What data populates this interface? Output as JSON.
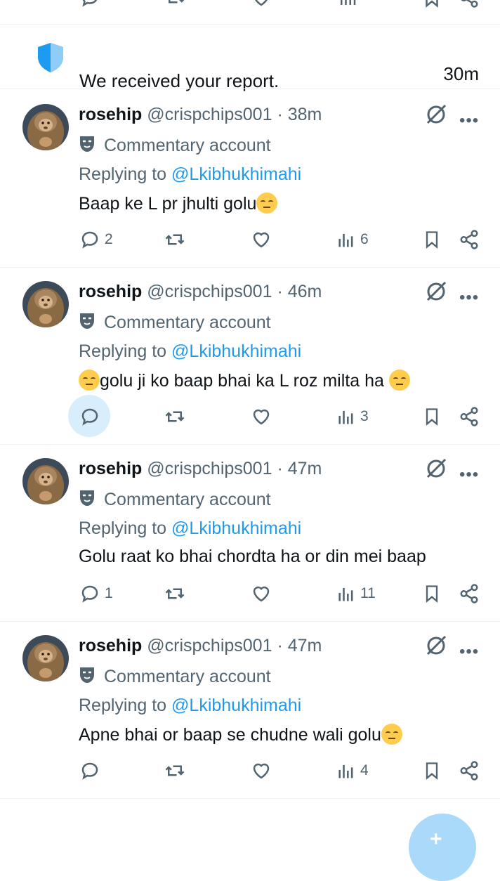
{
  "notice": {
    "text": "We received your report.",
    "time": "30m"
  },
  "posts": [
    {
      "name": "rosehip",
      "handle": "@crispchips001",
      "dot": "·",
      "time": "38m",
      "label": "Commentary account",
      "replying_prefix": "Replying to",
      "replying_to": "@Lkibhukhimahi",
      "text_before": "Baap ke L pr jhulti golu",
      "text_after": "",
      "emoji_before": false,
      "emoji_after": true,
      "replies": "2",
      "views": "6"
    },
    {
      "name": "rosehip",
      "handle": "@crispchips001",
      "dot": "·",
      "time": "46m",
      "label": "Commentary account",
      "replying_prefix": "Replying to",
      "replying_to": "@Lkibhukhimahi",
      "text_before": "golu ji ko baap bhai ka L roz milta ha",
      "text_after": "",
      "emoji_before": true,
      "emoji_after": true,
      "replies": "",
      "views": "3"
    },
    {
      "name": "rosehip",
      "handle": "@crispchips001",
      "dot": "·",
      "time": "47m",
      "label": "Commentary account",
      "replying_prefix": "Replying to",
      "replying_to": "@Lkibhukhimahi",
      "text_before": "Golu raat ko bhai chordta ha or din mei baap",
      "text_after": "",
      "emoji_before": false,
      "emoji_after": false,
      "replies": "1",
      "views": "11"
    },
    {
      "name": "rosehip",
      "handle": "@crispchips001",
      "dot": "·",
      "time": "47m",
      "label": "Commentary account",
      "replying_prefix": "Replying to",
      "replying_to": "@Lkibhukhimahi",
      "text_before": "Apne bhai or baap se chudne wali golu",
      "text_after": "",
      "emoji_before": false,
      "emoji_after": true,
      "replies": "",
      "views": "4"
    }
  ],
  "colors": {
    "accent": "#1d9bf0",
    "secondary_text": "#536471",
    "divider": "#eff3f4",
    "highlight": "#d9eefc"
  },
  "icons": [
    "comment-icon",
    "retweet-icon",
    "like-icon",
    "views-icon",
    "bookmark-icon",
    "share-icon",
    "grok-icon",
    "more-icon",
    "shield-icon",
    "mask-icon",
    "compose-icon"
  ]
}
